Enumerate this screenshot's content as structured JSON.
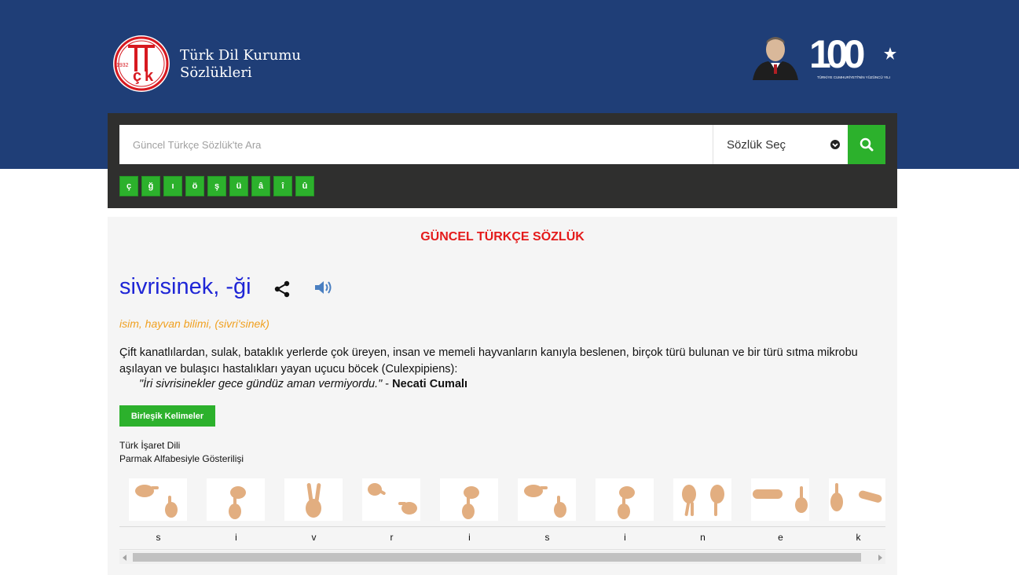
{
  "header": {
    "brand_line1": "Türk Dil Kurumu",
    "brand_line2": "Sözlükleri",
    "logo_year": "1932",
    "logo_letters": "TDK",
    "centennial_number": "100",
    "centennial_caption": "TÜRKİYE CUMHURİYETİ'NİN YÜZÜNCÜ YILI",
    "band_color": "#1f3e77"
  },
  "search": {
    "placeholder": "Güncel Türkçe Sözlük'te Ara",
    "value": "",
    "dictionary_select": "Sözlük Seç",
    "letters": [
      "ç",
      "ğ",
      "ı",
      "ö",
      "ş",
      "ü",
      "â",
      "î",
      "û"
    ],
    "accent_color": "#2cb12c"
  },
  "main": {
    "dictionary_title": "GÜNCEL TÜRKÇE SÖZLÜK",
    "word": "sivrisinek, -ği",
    "meta": "isim, hayvan bilimi, (sivri'sinek)",
    "definition": "Çift kanatlılardan, sulak, bataklık yerlerde çok üreyen, insan ve memeli hayvanların kanıyla beslenen, birçok türü bulunan ve bir türü sıtma mikrobu aşılayan ve bulaşıcı hastalıkları yayan uçucu böcek (Culexpipiens):",
    "example_quote": "\"İri sivrisinekler gece gündüz aman vermiyordu.\"",
    "example_separator": " - ",
    "example_author": "Necati Cumalı",
    "compound_button": "Birleşik Kelimeler",
    "sign_language_line1": "Türk İşaret Dili",
    "sign_language_line2": "Parmak Alfabesiyle Gösterilişi",
    "finger_letters": [
      "s",
      "i",
      "v",
      "r",
      "i",
      "s",
      "i",
      "n",
      "e",
      "k"
    ],
    "title_color": "#e41b1b",
    "word_color": "#1f26d6",
    "meta_color": "#f0a020"
  }
}
